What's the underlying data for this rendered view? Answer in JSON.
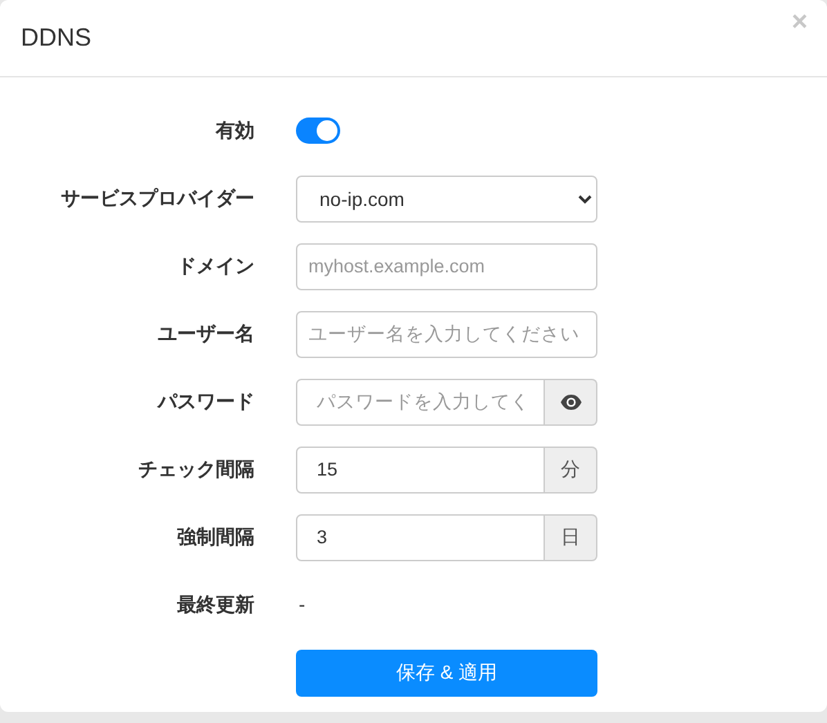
{
  "dialog": {
    "title": "DDNS",
    "close": "×"
  },
  "fields": [
    {
      "kind": "toggle",
      "label": "有効",
      "on": true
    },
    {
      "kind": "select",
      "label": "サービスプロバイダー",
      "value": "no-ip.com"
    },
    {
      "kind": "text",
      "label": "ドメイン",
      "placeholder": "myhost.example.com"
    },
    {
      "kind": "text",
      "label": "ユーザー名",
      "placeholder": "ユーザー名を入力してください"
    },
    {
      "kind": "password",
      "label": "パスワード",
      "placeholder": "パスワードを入力してく"
    },
    {
      "kind": "addon",
      "label": "チェック間隔",
      "value": "15",
      "addon": "分"
    },
    {
      "kind": "addon",
      "label": "強制間隔",
      "value": "3",
      "addon": "日"
    },
    {
      "kind": "static",
      "label": "最終更新",
      "value": "-"
    }
  ],
  "submit": {
    "label": "保存 & 適用"
  }
}
